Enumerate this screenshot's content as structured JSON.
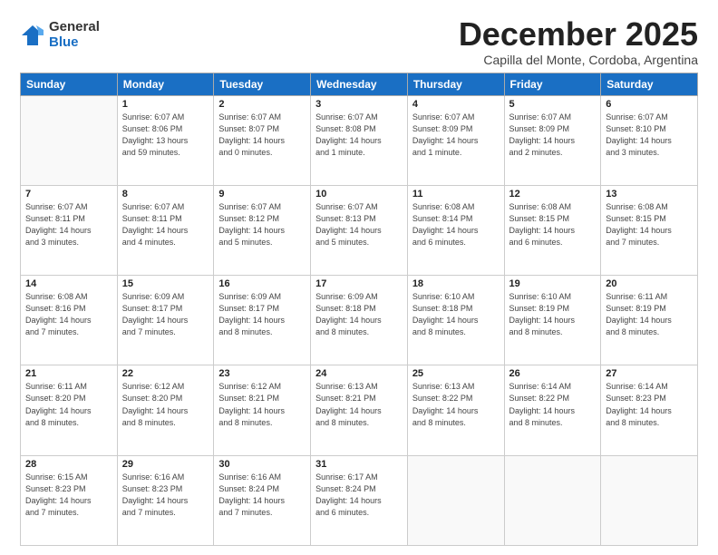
{
  "logo": {
    "general": "General",
    "blue": "Blue"
  },
  "header": {
    "month": "December 2025",
    "location": "Capilla del Monte, Cordoba, Argentina"
  },
  "weekdays": [
    "Sunday",
    "Monday",
    "Tuesday",
    "Wednesday",
    "Thursday",
    "Friday",
    "Saturday"
  ],
  "weeks": [
    [
      {
        "day": "",
        "detail": ""
      },
      {
        "day": "1",
        "detail": "Sunrise: 6:07 AM\nSunset: 8:06 PM\nDaylight: 13 hours\nand 59 minutes."
      },
      {
        "day": "2",
        "detail": "Sunrise: 6:07 AM\nSunset: 8:07 PM\nDaylight: 14 hours\nand 0 minutes."
      },
      {
        "day": "3",
        "detail": "Sunrise: 6:07 AM\nSunset: 8:08 PM\nDaylight: 14 hours\nand 1 minute."
      },
      {
        "day": "4",
        "detail": "Sunrise: 6:07 AM\nSunset: 8:09 PM\nDaylight: 14 hours\nand 1 minute."
      },
      {
        "day": "5",
        "detail": "Sunrise: 6:07 AM\nSunset: 8:09 PM\nDaylight: 14 hours\nand 2 minutes."
      },
      {
        "day": "6",
        "detail": "Sunrise: 6:07 AM\nSunset: 8:10 PM\nDaylight: 14 hours\nand 3 minutes."
      }
    ],
    [
      {
        "day": "7",
        "detail": "Sunrise: 6:07 AM\nSunset: 8:11 PM\nDaylight: 14 hours\nand 3 minutes."
      },
      {
        "day": "8",
        "detail": "Sunrise: 6:07 AM\nSunset: 8:11 PM\nDaylight: 14 hours\nand 4 minutes."
      },
      {
        "day": "9",
        "detail": "Sunrise: 6:07 AM\nSunset: 8:12 PM\nDaylight: 14 hours\nand 5 minutes."
      },
      {
        "day": "10",
        "detail": "Sunrise: 6:07 AM\nSunset: 8:13 PM\nDaylight: 14 hours\nand 5 minutes."
      },
      {
        "day": "11",
        "detail": "Sunrise: 6:08 AM\nSunset: 8:14 PM\nDaylight: 14 hours\nand 6 minutes."
      },
      {
        "day": "12",
        "detail": "Sunrise: 6:08 AM\nSunset: 8:15 PM\nDaylight: 14 hours\nand 6 minutes."
      },
      {
        "day": "13",
        "detail": "Sunrise: 6:08 AM\nSunset: 8:15 PM\nDaylight: 14 hours\nand 7 minutes."
      }
    ],
    [
      {
        "day": "14",
        "detail": "Sunrise: 6:08 AM\nSunset: 8:16 PM\nDaylight: 14 hours\nand 7 minutes."
      },
      {
        "day": "15",
        "detail": "Sunrise: 6:09 AM\nSunset: 8:17 PM\nDaylight: 14 hours\nand 7 minutes."
      },
      {
        "day": "16",
        "detail": "Sunrise: 6:09 AM\nSunset: 8:17 PM\nDaylight: 14 hours\nand 8 minutes."
      },
      {
        "day": "17",
        "detail": "Sunrise: 6:09 AM\nSunset: 8:18 PM\nDaylight: 14 hours\nand 8 minutes."
      },
      {
        "day": "18",
        "detail": "Sunrise: 6:10 AM\nSunset: 8:18 PM\nDaylight: 14 hours\nand 8 minutes."
      },
      {
        "day": "19",
        "detail": "Sunrise: 6:10 AM\nSunset: 8:19 PM\nDaylight: 14 hours\nand 8 minutes."
      },
      {
        "day": "20",
        "detail": "Sunrise: 6:11 AM\nSunset: 8:19 PM\nDaylight: 14 hours\nand 8 minutes."
      }
    ],
    [
      {
        "day": "21",
        "detail": "Sunrise: 6:11 AM\nSunset: 8:20 PM\nDaylight: 14 hours\nand 8 minutes."
      },
      {
        "day": "22",
        "detail": "Sunrise: 6:12 AM\nSunset: 8:20 PM\nDaylight: 14 hours\nand 8 minutes."
      },
      {
        "day": "23",
        "detail": "Sunrise: 6:12 AM\nSunset: 8:21 PM\nDaylight: 14 hours\nand 8 minutes."
      },
      {
        "day": "24",
        "detail": "Sunrise: 6:13 AM\nSunset: 8:21 PM\nDaylight: 14 hours\nand 8 minutes."
      },
      {
        "day": "25",
        "detail": "Sunrise: 6:13 AM\nSunset: 8:22 PM\nDaylight: 14 hours\nand 8 minutes."
      },
      {
        "day": "26",
        "detail": "Sunrise: 6:14 AM\nSunset: 8:22 PM\nDaylight: 14 hours\nand 8 minutes."
      },
      {
        "day": "27",
        "detail": "Sunrise: 6:14 AM\nSunset: 8:23 PM\nDaylight: 14 hours\nand 8 minutes."
      }
    ],
    [
      {
        "day": "28",
        "detail": "Sunrise: 6:15 AM\nSunset: 8:23 PM\nDaylight: 14 hours\nand 7 minutes."
      },
      {
        "day": "29",
        "detail": "Sunrise: 6:16 AM\nSunset: 8:23 PM\nDaylight: 14 hours\nand 7 minutes."
      },
      {
        "day": "30",
        "detail": "Sunrise: 6:16 AM\nSunset: 8:24 PM\nDaylight: 14 hours\nand 7 minutes."
      },
      {
        "day": "31",
        "detail": "Sunrise: 6:17 AM\nSunset: 8:24 PM\nDaylight: 14 hours\nand 6 minutes."
      },
      {
        "day": "",
        "detail": ""
      },
      {
        "day": "",
        "detail": ""
      },
      {
        "day": "",
        "detail": ""
      }
    ]
  ]
}
